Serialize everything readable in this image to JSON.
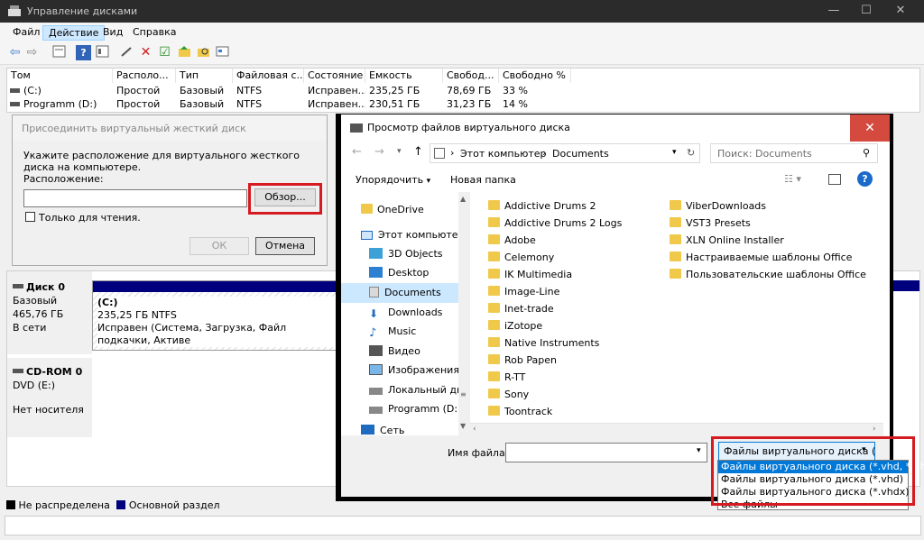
{
  "window": {
    "title": "Управление дисками"
  },
  "menu": [
    "Файл",
    "Действие",
    "Вид",
    "Справка"
  ],
  "volumes": {
    "headers": [
      "Том",
      "Располо...",
      "Тип",
      "Файловая с...",
      "Состояние",
      "Емкость",
      "Свобод...",
      "Свободно %"
    ],
    "rows": [
      [
        "(C:)",
        "Простой",
        "Базовый",
        "NTFS",
        "Исправен...",
        "235,25 ГБ",
        "78,69 ГБ",
        "33 %"
      ],
      [
        "Programm (D:)",
        "Простой",
        "Базовый",
        "NTFS",
        "Исправен...",
        "230,51 ГБ",
        "31,23 ГБ",
        "14 %"
      ]
    ]
  },
  "disks": {
    "disk0": {
      "name": "Диск 0",
      "type": "Базовый",
      "size": "465,76 ГБ",
      "status": "В сети",
      "partition": {
        "label": "(C:)",
        "fs": "235,25 ГБ NTFS",
        "status": "Исправен (Система, Загрузка, Файл подкачки, Активе"
      }
    },
    "cdrom": {
      "name": "CD-ROM 0",
      "drive": "DVD (E:)",
      "status": "Нет носителя"
    }
  },
  "legend": {
    "unallocated": "Не распределена",
    "primary": "Основной раздел"
  },
  "attach_dialog": {
    "title": "Присоединить виртуальный жесткий диск",
    "instruction": "Укажите расположение для виртуального жесткого диска на компьютере.",
    "location_label": "Расположение:",
    "location_value": "",
    "browse": "Обзор...",
    "readonly": "Только для чтения.",
    "ok": "ОК",
    "cancel": "Отмена"
  },
  "file_dialog": {
    "title": "Просмотр файлов виртуального диска",
    "breadcrumb": [
      "Этот компьютер",
      "Documents"
    ],
    "search_placeholder": "Поиск: Documents",
    "organize": "Упорядочить",
    "new_folder": "Новая папка",
    "nav": [
      "OneDrive",
      "Этот компьютер",
      "3D Objects",
      "Desktop",
      "Documents",
      "Downloads",
      "Music",
      "Видео",
      "Изображения",
      "Локальный дис",
      "Programm (D:)",
      "Сеть"
    ],
    "files_col1": [
      "Addictive Drums 2",
      "Addictive Drums 2 Logs",
      "Adobe",
      "Celemony",
      "IK Multimedia",
      "Image-Line",
      "Inet-trade",
      "iZotope",
      "Native Instruments",
      "Rob Papen",
      "R-TT",
      "Sony",
      "Toontrack"
    ],
    "files_col2": [
      "ViberDownloads",
      "VST3 Presets",
      "XLN Online Installer",
      "Настраиваемые шаблоны Office",
      "Пользовательские шаблоны Office"
    ],
    "filename_label": "Имя файла:",
    "filename_value": "",
    "filter_selected": "Файлы виртуального диска (*",
    "filter_options": [
      "Файлы виртуального диска (*.vhd, *.vhdx)",
      "Файлы виртуального диска (*.vhd)",
      "Файлы виртуального диска (*.vhdx)",
      "Все файлы"
    ]
  },
  "colors": {
    "accent": "#0078d7",
    "highlight": "#d51b21",
    "primary_partition": "#00007e",
    "folder": "#f0c94b"
  }
}
